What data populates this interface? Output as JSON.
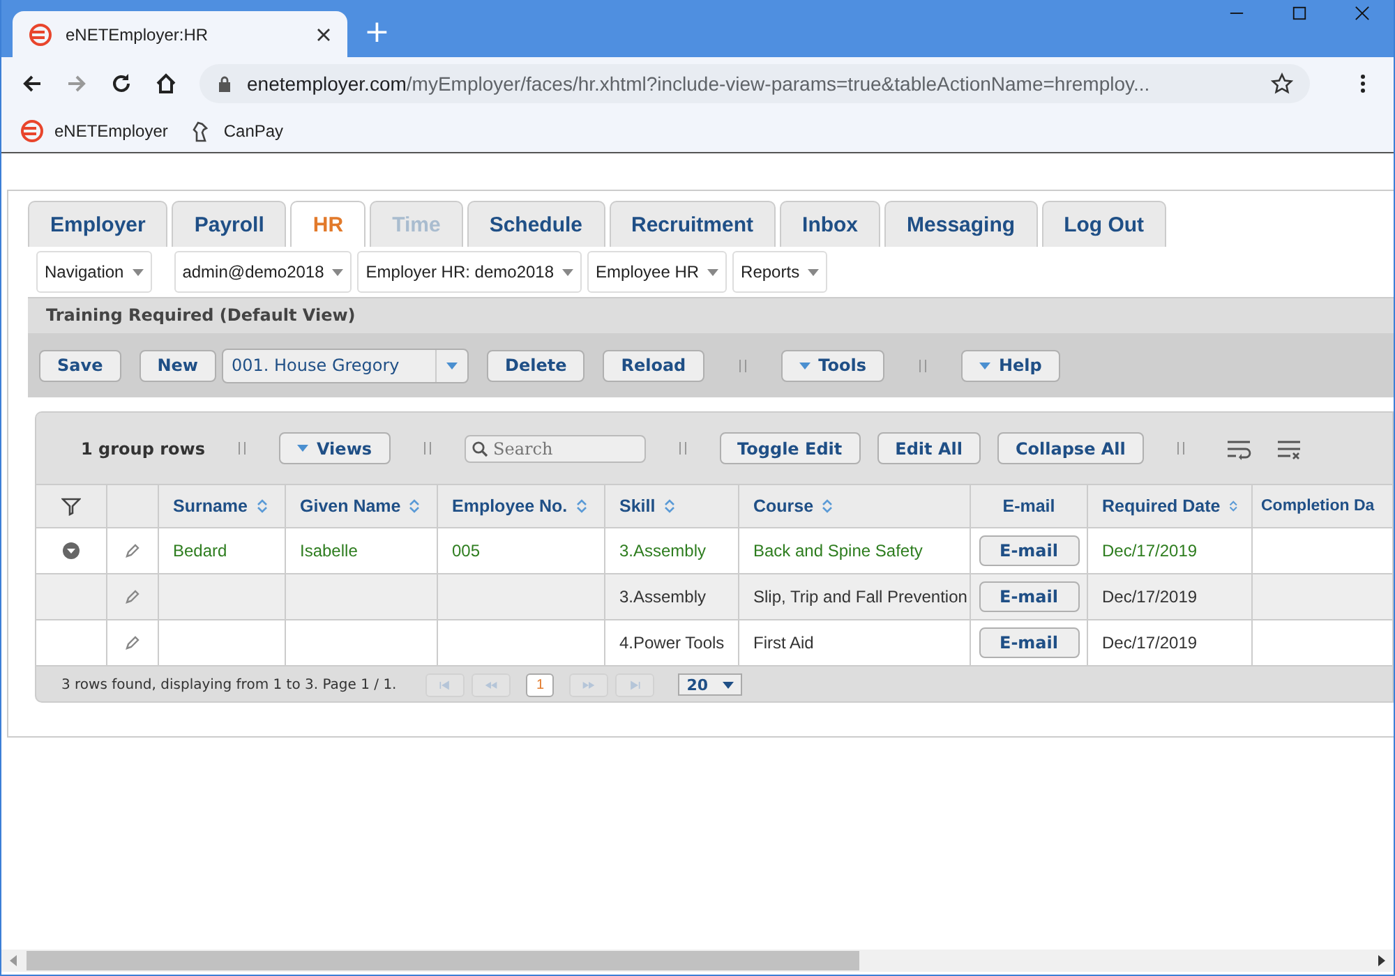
{
  "browser": {
    "tab_title": "eNETEmployer:HR",
    "new_tab": "+",
    "url_host": "enetemployer.com",
    "url_path": "/myEmployer/faces/hr.xhtml?include-view-params=true&tableActionName=hremploy...",
    "bookmarks": [
      {
        "kind": "logo",
        "label": "eNETEmployer"
      },
      {
        "kind": "horse",
        "label": "CanPay"
      }
    ]
  },
  "tabs": [
    {
      "label": "Employer",
      "selected": false,
      "disabled": false
    },
    {
      "label": "Payroll",
      "selected": false,
      "disabled": false
    },
    {
      "label": "HR",
      "selected": true,
      "disabled": false
    },
    {
      "label": "Time",
      "selected": false,
      "disabled": true
    },
    {
      "label": "Schedule",
      "selected": false,
      "disabled": false
    },
    {
      "label": "Recruitment",
      "selected": false,
      "disabled": false
    },
    {
      "label": "Inbox",
      "selected": false,
      "disabled": false
    },
    {
      "label": "Messaging",
      "selected": false,
      "disabled": false
    },
    {
      "label": "Log Out",
      "selected": false,
      "disabled": false
    }
  ],
  "nav_menus": [
    "Navigation",
    "admin@demo2018",
    "Employer HR: demo2018",
    "Employee HR",
    "Reports"
  ],
  "panel_title": "Training Required (Default View)",
  "toolbar": [
    {
      "kind": "button",
      "label": "Save"
    },
    {
      "kind": "button",
      "label": "New"
    },
    {
      "kind": "combo",
      "label": "001. House Gregory"
    },
    {
      "kind": "button",
      "label": "Delete"
    },
    {
      "kind": "button",
      "label": "Reload"
    },
    {
      "kind": "divider"
    },
    {
      "kind": "menu",
      "label": "Tools"
    },
    {
      "kind": "divider"
    },
    {
      "kind": "menu",
      "label": "Help"
    }
  ],
  "grid_toolbar": [
    {
      "kind": "text",
      "label": "1 group rows"
    },
    {
      "kind": "divider"
    },
    {
      "kind": "menu",
      "label": "Views"
    },
    {
      "kind": "divider"
    },
    {
      "kind": "search",
      "placeholder": "Search"
    },
    {
      "kind": "divider"
    },
    {
      "kind": "button",
      "label": "Toggle Edit"
    },
    {
      "kind": "button",
      "label": "Edit All"
    },
    {
      "kind": "button",
      "label": "Collapse All"
    },
    {
      "kind": "divider"
    }
  ],
  "table": {
    "columns": [
      {
        "label": "Surname",
        "sortable": true,
        "kind": "text"
      },
      {
        "label": "Given Name",
        "sortable": true,
        "kind": "text"
      },
      {
        "label": "Employee No.",
        "sortable": true,
        "kind": "text"
      },
      {
        "label": "Skill",
        "sortable": true,
        "kind": "text"
      },
      {
        "label": "Course",
        "sortable": true,
        "kind": "text"
      },
      {
        "label": "E-mail",
        "sortable": false,
        "kind": "button"
      },
      {
        "label": "Required Date",
        "sortable": true,
        "kind": "text"
      },
      {
        "label": "Completion Da",
        "kind": "text"
      }
    ],
    "rows": [
      {
        "group_header": true,
        "selected": false,
        "cells": [
          "Bedard",
          "Isabelle",
          "005",
          "3.Assembly",
          "Back and Spine Safety",
          "E-mail",
          "Dec/17/2019",
          null
        ]
      },
      {
        "group_header": false,
        "selected": true,
        "cells": [
          null,
          null,
          null,
          "3.Assembly",
          "Slip, Trip and Fall Prevention",
          "E-mail",
          "Dec/17/2019",
          null
        ]
      },
      {
        "group_header": false,
        "selected": false,
        "cells": [
          null,
          null,
          null,
          "4.Power Tools",
          "First Aid",
          "E-mail",
          "Dec/17/2019",
          null
        ]
      }
    ]
  },
  "footer": {
    "summary": "3 rows found, displaying from 1 to 3. Page 1 / 1.",
    "nav": [
      {
        "kind": "first",
        "disabled": true
      },
      {
        "kind": "prev",
        "disabled": true
      },
      {
        "kind": "page",
        "label": "1",
        "selected": true
      },
      {
        "kind": "next",
        "disabled": true
      },
      {
        "kind": "last",
        "disabled": true
      }
    ],
    "page_size": "20"
  }
}
